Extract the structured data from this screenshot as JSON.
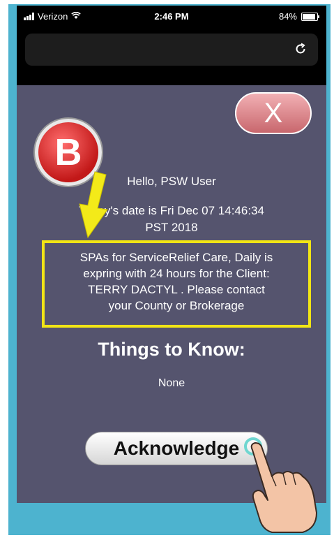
{
  "status_bar": {
    "carrier": "Verizon",
    "time": "2:46 PM",
    "battery": "84%"
  },
  "close_button": {
    "label": "X"
  },
  "annotation": {
    "badge_letter": "B"
  },
  "greeting": "Hello, PSW User",
  "date_line": {
    "part1": "Today's date is Fri Dec 07 14:46:34",
    "part2": "PST 2018"
  },
  "alert": {
    "line1": "SPAs for ServiceRelief Care, Daily is",
    "line2": "expring with 24 hours for the Client:",
    "line3": "TERRY DACTYL . Please contact",
    "line4": "your County or Brokerage"
  },
  "things_to_know": {
    "title": "Things to Know:",
    "content": "None"
  },
  "acknowledge_button": {
    "label": "Acknowledge"
  },
  "colors": {
    "frame": "#4db3cf",
    "screen_bg": "#55546e",
    "alert_border": "#f1e515",
    "close_button": "#d97a80",
    "badge": "#d42222"
  }
}
